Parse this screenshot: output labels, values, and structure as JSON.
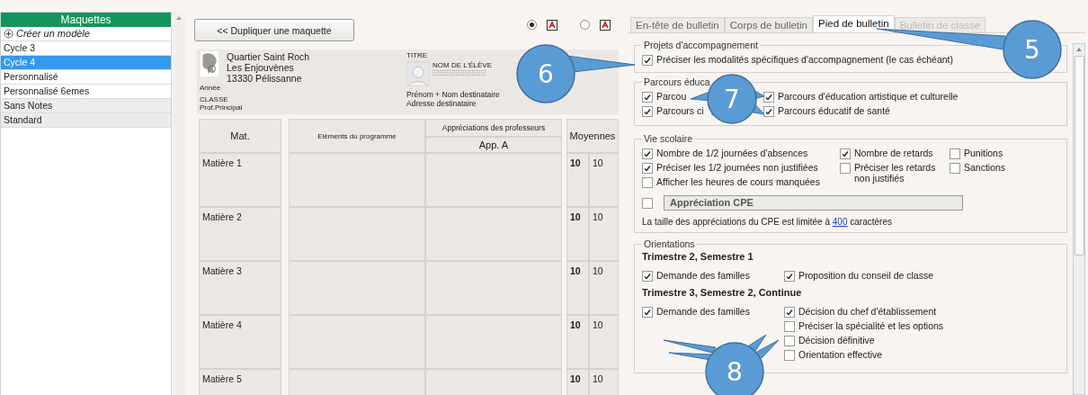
{
  "sidebar": {
    "header": "Maquettes",
    "create_label": "Créer un modèle",
    "items": [
      {
        "label": "Cycle 3",
        "selected": false,
        "kind": "custom"
      },
      {
        "label": "Cycle 4",
        "selected": true,
        "kind": "custom"
      },
      {
        "label": "Personnalisé",
        "selected": false,
        "kind": "custom"
      },
      {
        "label": "Personnalisé 6emes",
        "selected": false,
        "kind": "custom"
      },
      {
        "label": "Sans Notes",
        "selected": false,
        "kind": "preset"
      },
      {
        "label": "Standard",
        "selected": false,
        "kind": "preset"
      }
    ]
  },
  "toolbar": {
    "duplicate_button": "<< Dupliquer une maquette",
    "formats": [
      {
        "selected": true
      },
      {
        "selected": false
      }
    ]
  },
  "preview": {
    "address": [
      "Quartier Saint Roch",
      "Les Enjouvènes",
      "13330 Pélissanne"
    ],
    "year": "Année",
    "class_lines": [
      "CLASSE",
      "Prof.Principal"
    ],
    "title": "TITRE",
    "student": "NOM DE L'ÉLÈVE",
    "recipient": [
      "Prénom + Nom destinataire",
      "Adresse destinataire"
    ]
  },
  "table": {
    "columns": {
      "subject": "Mat.",
      "program": "Eléments du programme",
      "appreciations": "Appréciations des professeurs",
      "app_a": "App. A",
      "averages": "Moyennes"
    },
    "rows": [
      {
        "subject": "Matière 1",
        "avg_1": "10",
        "avg_2": "10"
      },
      {
        "subject": "Matière 2",
        "avg_1": "10",
        "avg_2": "10"
      },
      {
        "subject": "Matière 3",
        "avg_1": "10",
        "avg_2": "10"
      },
      {
        "subject": "Matière 4",
        "avg_1": "10",
        "avg_2": "10"
      },
      {
        "subject": "Matière 5",
        "avg_1": "10",
        "avg_2": "10"
      }
    ]
  },
  "tabs": [
    {
      "label": "En-tête de bulletin",
      "selected": false,
      "disabled": false
    },
    {
      "label": "Corps de bulletin",
      "selected": false,
      "disabled": false
    },
    {
      "label": "Pied de bulletin",
      "selected": true,
      "disabled": false
    },
    {
      "label": "Bulletin de classe",
      "selected": false,
      "disabled": true
    }
  ],
  "projets": {
    "title": "Projets d'accompagnement",
    "items": [
      {
        "label": "Préciser les modalités spécifiques d'accompagnement (le cas échéant)",
        "checked": true
      }
    ]
  },
  "parcours": {
    "title": "Parcours éduca",
    "columns": [
      [
        {
          "label": "Parcou",
          "checked": true
        },
        {
          "label": "Parcours ci",
          "checked": true
        }
      ],
      [
        {
          "label": "Parcours d'éducation artistique et culturelle",
          "checked": true
        },
        {
          "label": "Parcours éducatif de santé",
          "checked": true
        }
      ]
    ]
  },
  "vie_scolaire": {
    "title": "Vie scolaire",
    "columns": [
      [
        {
          "label": "Nombre de 1/2 journées d'absences",
          "checked": true
        },
        {
          "label": "Préciser les 1/2 journées non justifiées",
          "checked": true
        },
        {
          "label": "Afficher les heures de cours manquées",
          "checked": false
        }
      ],
      [
        {
          "label": "Nombre de retards",
          "checked": true
        },
        {
          "label": "Préciser les retards non justifiés",
          "checked": false
        }
      ],
      [
        {
          "label": "Punitions",
          "checked": false
        },
        {
          "label": "Sanctions",
          "checked": false
        }
      ]
    ],
    "cpe": {
      "checked": false,
      "value": "Appréciation CPE"
    },
    "note_before": "La taille des appréciations du CPE est limitée à",
    "note_link": "400",
    "note_after": "caractères"
  },
  "orientations": {
    "title": "Orientations",
    "groups": [
      {
        "title": "Trimestre 2, Semestre 1",
        "columns": [
          [
            {
              "label": "Demande des familles",
              "checked": true
            }
          ],
          [
            {
              "label": "Proposition du conseil de classe",
              "checked": true
            }
          ]
        ]
      },
      {
        "title": "Trimestre 3, Semestre 2, Continue",
        "columns": [
          [
            {
              "label": "Demande des familles",
              "checked": true
            }
          ],
          [
            {
              "label": "Décision du chef d'établissement",
              "checked": true,
              "children": [
                {
                  "label": "Préciser la spécialité et les options",
                  "checked": false
                }
              ]
            },
            {
              "label": "Décision définitive",
              "checked": false
            },
            {
              "label": "Orientation effective",
              "checked": false
            }
          ]
        ]
      }
    ]
  },
  "callouts": [
    {
      "number": "5"
    },
    {
      "number": "6"
    },
    {
      "number": "7"
    },
    {
      "number": "8"
    }
  ]
}
